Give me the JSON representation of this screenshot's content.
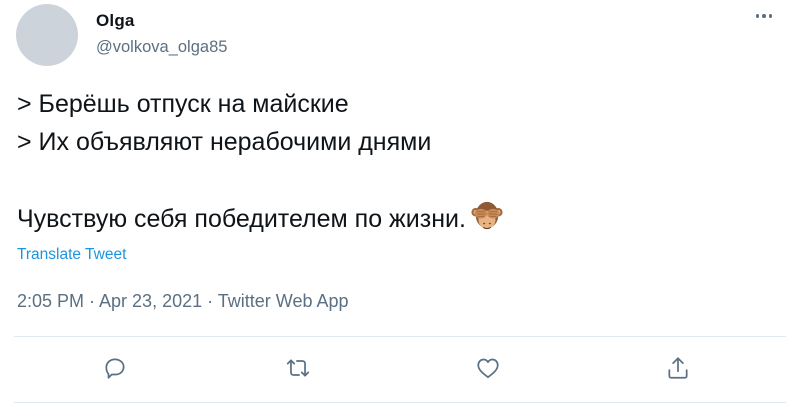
{
  "author": {
    "display_name": "Olga",
    "handle": "@volkova_olga85"
  },
  "tweet": {
    "lines": [
      "> Берёшь отпуск на майские",
      "> Их объявляют нерабочими днями",
      "Чувствую себя победителем по жизни."
    ],
    "emoji": "see-no-evil-monkey"
  },
  "translate_label": "Translate Tweet",
  "meta": "2:05 PM · Apr 23, 2021 · Twitter Web App",
  "actions": {
    "reply": "reply-icon",
    "retweet": "retweet-icon",
    "like": "heart-icon",
    "share": "share-icon"
  },
  "colors": {
    "text": "#0f1419",
    "secondary": "#5b7083",
    "link": "#1b95e0",
    "divider": "#e1e8ed"
  }
}
